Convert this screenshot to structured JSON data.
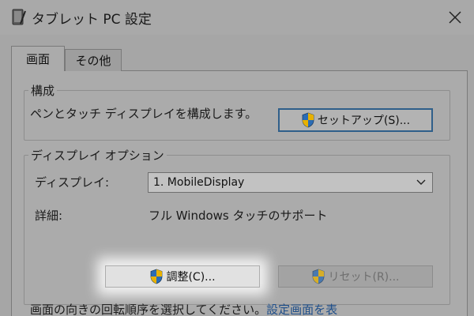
{
  "window": {
    "title": "タブレット PC 設定",
    "icon": "tablet-pc-icon",
    "close_icon": "close-icon"
  },
  "tabs": [
    {
      "label": "画面",
      "active": true
    },
    {
      "label": "その他",
      "active": false
    }
  ],
  "config_group": {
    "legend": "構成",
    "description": "ペンとタッチ ディスプレイを構成します。",
    "setup_button": "セットアップ(S)..."
  },
  "display_group": {
    "legend": "ディスプレイ オプション",
    "display_label": "ディスプレイ:",
    "display_selected": "1. MobileDisplay",
    "details_label": "詳細:",
    "details_value": "フル Windows タッチのサポート",
    "adjust_button": "調整(C)...",
    "reset_button": "リセット(R)...",
    "reset_enabled": false
  },
  "footer": {
    "text": "画面の向きの回転順序を選択してください。",
    "link": "設定画面を表"
  },
  "colors": {
    "shield_blue": "#2b6cb5",
    "shield_yellow": "#e8b100",
    "link": "#1f4f8a"
  }
}
